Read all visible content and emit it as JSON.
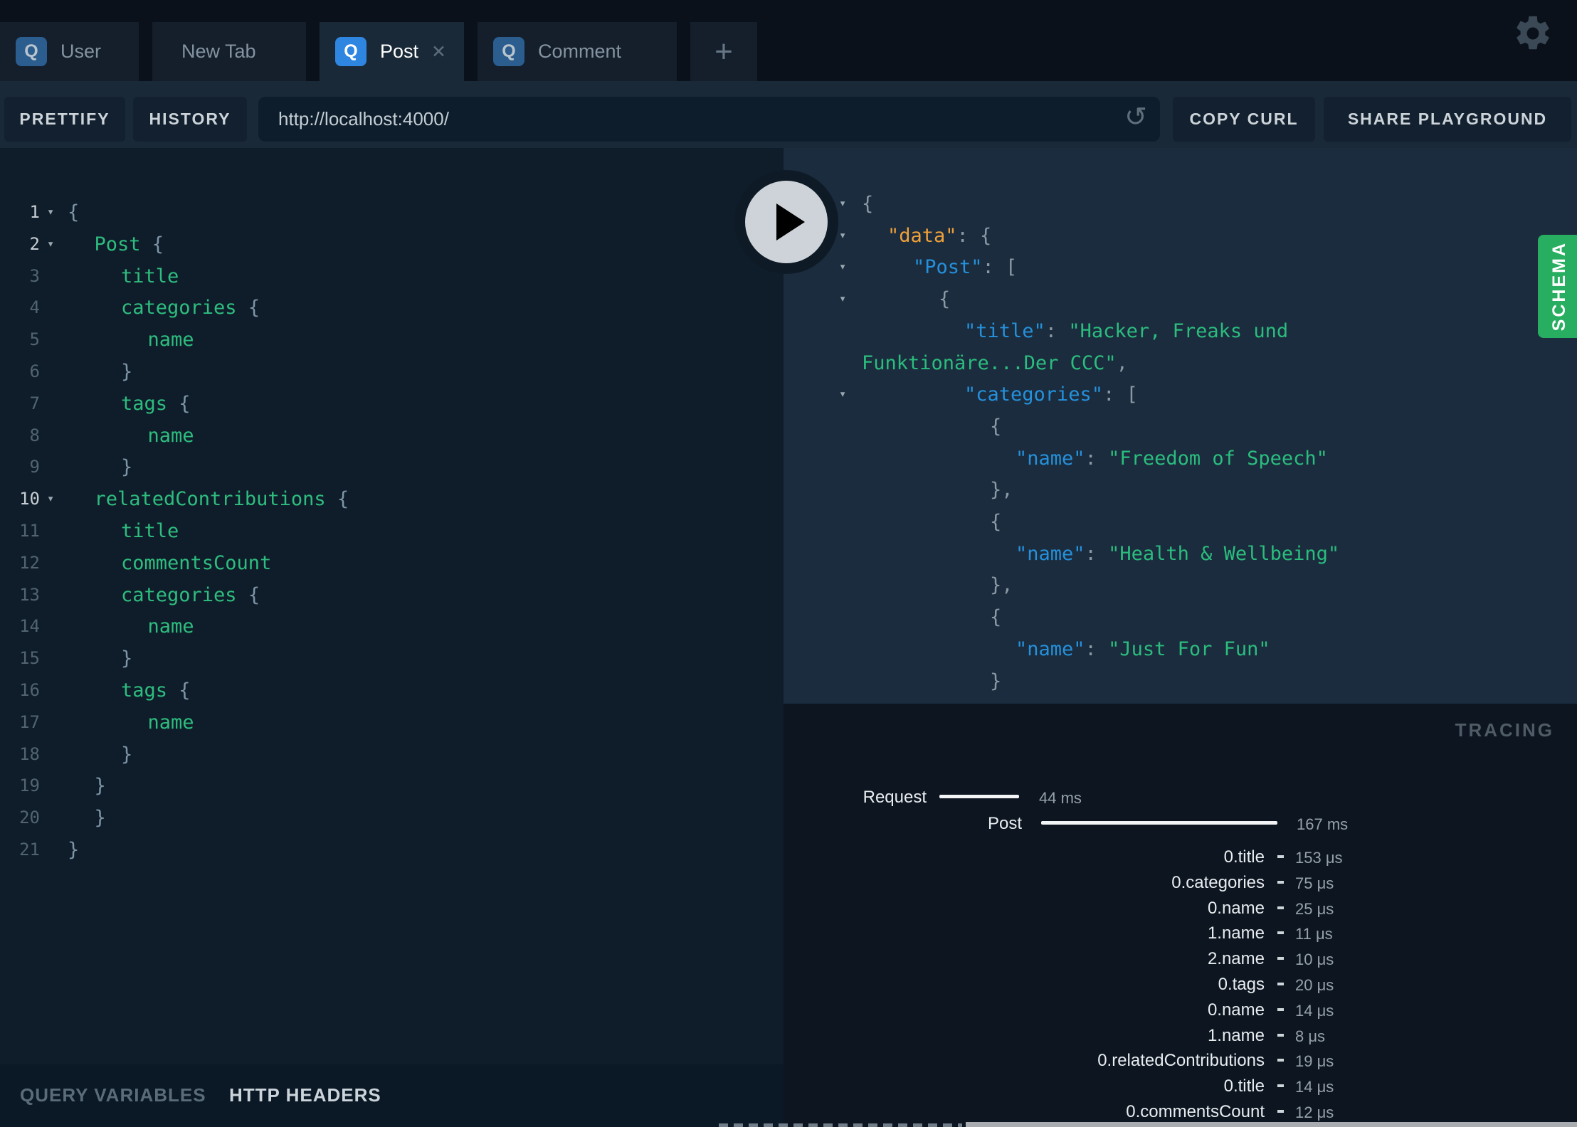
{
  "tabs": {
    "items": [
      {
        "label": "User",
        "badge": "Q",
        "active": false,
        "closable": false
      },
      {
        "label": "New Tab",
        "badge": "",
        "active": false,
        "closable": false
      },
      {
        "label": "Post",
        "badge": "Q",
        "active": true,
        "closable": true
      },
      {
        "label": "Comment",
        "badge": "Q",
        "active": false,
        "closable": false
      }
    ],
    "new_tab_button": "+"
  },
  "icons": {
    "settings": "gear-icon",
    "reload_glyph": "↺",
    "close_glyph": "✕",
    "fold_glyph": "▾",
    "play": "play-triangle"
  },
  "toolbar": {
    "prettify": "PRETTIFY",
    "history": "HISTORY",
    "url": "http://localhost:4000/",
    "copy_curl": "COPY CURL",
    "share_playground": "SHARE PLAYGROUND"
  },
  "query_editor": {
    "lines": [
      {
        "n": 1,
        "fold": true,
        "indent": 0,
        "tokens": [
          [
            "p",
            "{"
          ]
        ]
      },
      {
        "n": 2,
        "fold": true,
        "indent": 1,
        "tokens": [
          [
            "f",
            "Post"
          ],
          [
            "p",
            " {"
          ]
        ]
      },
      {
        "n": 3,
        "fold": false,
        "indent": 2,
        "tokens": [
          [
            "f",
            "title"
          ]
        ]
      },
      {
        "n": 4,
        "fold": false,
        "indent": 2,
        "tokens": [
          [
            "f",
            "categories"
          ],
          [
            "p",
            " {"
          ]
        ]
      },
      {
        "n": 5,
        "fold": false,
        "indent": 3,
        "tokens": [
          [
            "f",
            "name"
          ]
        ]
      },
      {
        "n": 6,
        "fold": false,
        "indent": 2,
        "tokens": [
          [
            "p",
            "}"
          ]
        ]
      },
      {
        "n": 7,
        "fold": false,
        "indent": 2,
        "tokens": [
          [
            "f",
            "tags"
          ],
          [
            "p",
            " {"
          ]
        ]
      },
      {
        "n": 8,
        "fold": false,
        "indent": 3,
        "tokens": [
          [
            "f",
            "name"
          ]
        ]
      },
      {
        "n": 9,
        "fold": false,
        "indent": 2,
        "tokens": [
          [
            "p",
            "}"
          ]
        ]
      },
      {
        "n": 10,
        "fold": true,
        "indent": 1,
        "tokens": [
          [
            "f",
            "relatedContributions"
          ],
          [
            "p",
            " {"
          ]
        ]
      },
      {
        "n": 11,
        "fold": false,
        "indent": 2,
        "tokens": [
          [
            "f",
            "title"
          ]
        ]
      },
      {
        "n": 12,
        "fold": false,
        "indent": 2,
        "tokens": [
          [
            "f",
            "commentsCount"
          ]
        ]
      },
      {
        "n": 13,
        "fold": false,
        "indent": 2,
        "tokens": [
          [
            "f",
            "categories"
          ],
          [
            "p",
            " {"
          ]
        ]
      },
      {
        "n": 14,
        "fold": false,
        "indent": 3,
        "tokens": [
          [
            "f",
            "name"
          ]
        ]
      },
      {
        "n": 15,
        "fold": false,
        "indent": 2,
        "tokens": [
          [
            "p",
            "}"
          ]
        ]
      },
      {
        "n": 16,
        "fold": false,
        "indent": 2,
        "tokens": [
          [
            "f",
            "tags"
          ],
          [
            "p",
            " {"
          ]
        ]
      },
      {
        "n": 17,
        "fold": false,
        "indent": 3,
        "tokens": [
          [
            "f",
            "name"
          ]
        ]
      },
      {
        "n": 18,
        "fold": false,
        "indent": 2,
        "tokens": [
          [
            "p",
            "}"
          ]
        ]
      },
      {
        "n": 19,
        "fold": false,
        "indent": 1,
        "tokens": [
          [
            "p",
            "}"
          ]
        ]
      },
      {
        "n": 20,
        "fold": false,
        "indent": 1,
        "tokens": [
          [
            "p",
            "}"
          ]
        ]
      },
      {
        "n": 21,
        "fold": false,
        "indent": 0,
        "tokens": [
          [
            "p",
            "}"
          ]
        ]
      }
    ]
  },
  "response": {
    "lines": [
      {
        "fold": true,
        "indent": 0,
        "tokens": [
          [
            "p",
            "{"
          ]
        ]
      },
      {
        "fold": true,
        "indent": 1,
        "tokens": [
          [
            "o",
            "\"data\""
          ],
          [
            "p",
            ": {"
          ]
        ]
      },
      {
        "fold": true,
        "indent": 2,
        "tokens": [
          [
            "k",
            "\"Post\""
          ],
          [
            "p",
            ": ["
          ]
        ]
      },
      {
        "fold": true,
        "indent": 3,
        "tokens": [
          [
            "p",
            "{"
          ]
        ]
      },
      {
        "fold": false,
        "indent": 4,
        "tokens": [
          [
            "k",
            "\"title\""
          ],
          [
            "p",
            ": "
          ],
          [
            "s",
            "\"Hacker, Freaks und"
          ]
        ]
      },
      {
        "fold": false,
        "indent": 0,
        "tokens": [
          [
            "s",
            "Funktionäre...Der CCC\""
          ],
          [
            "p",
            ","
          ]
        ]
      },
      {
        "fold": true,
        "indent": 4,
        "tokens": [
          [
            "k",
            "\"categories\""
          ],
          [
            "p",
            ": ["
          ]
        ]
      },
      {
        "fold": false,
        "indent": 5,
        "tokens": [
          [
            "p",
            "{"
          ]
        ]
      },
      {
        "fold": false,
        "indent": 6,
        "tokens": [
          [
            "k",
            "\"name\""
          ],
          [
            "p",
            ": "
          ],
          [
            "s",
            "\"Freedom of Speech\""
          ]
        ]
      },
      {
        "fold": false,
        "indent": 5,
        "tokens": [
          [
            "p",
            "},"
          ]
        ]
      },
      {
        "fold": false,
        "indent": 5,
        "tokens": [
          [
            "p",
            "{"
          ]
        ]
      },
      {
        "fold": false,
        "indent": 6,
        "tokens": [
          [
            "k",
            "\"name\""
          ],
          [
            "p",
            ": "
          ],
          [
            "s",
            "\"Health & Wellbeing\""
          ]
        ]
      },
      {
        "fold": false,
        "indent": 5,
        "tokens": [
          [
            "p",
            "},"
          ]
        ]
      },
      {
        "fold": false,
        "indent": 5,
        "tokens": [
          [
            "p",
            "{"
          ]
        ]
      },
      {
        "fold": false,
        "indent": 6,
        "tokens": [
          [
            "k",
            "\"name\""
          ],
          [
            "p",
            ": "
          ],
          [
            "s",
            "\"Just For Fun\""
          ]
        ]
      },
      {
        "fold": false,
        "indent": 5,
        "tokens": [
          [
            "p",
            "}"
          ]
        ]
      },
      {
        "fold": false,
        "indent": 4,
        "tokens": [
          [
            "p",
            "]"
          ]
        ]
      }
    ]
  },
  "schema_tab": {
    "label": "SCHEMA",
    "color": "#27ae60"
  },
  "tracing": {
    "header": "TRACING",
    "request": {
      "label": "Request",
      "duration": "44 ms"
    },
    "resolver": {
      "label": "Post",
      "duration": "167 ms"
    },
    "fields": [
      {
        "name": "0.title",
        "duration": "153 μs"
      },
      {
        "name": "0.categories",
        "duration": "75 μs"
      },
      {
        "name": "0.name",
        "duration": "25 μs"
      },
      {
        "name": "1.name",
        "duration": "11 μs"
      },
      {
        "name": "2.name",
        "duration": "10 μs"
      },
      {
        "name": "0.tags",
        "duration": "20 μs"
      },
      {
        "name": "0.name",
        "duration": "14 μs"
      },
      {
        "name": "1.name",
        "duration": "8 μs"
      },
      {
        "name": "0.relatedContributions",
        "duration": "19 μs"
      },
      {
        "name": "0.title",
        "duration": "14 μs"
      },
      {
        "name": "0.commentsCount",
        "duration": "12 μs"
      }
    ]
  },
  "footer": {
    "query_variables": "QUERY VARIABLES",
    "http_headers": "HTTP HEADERS"
  },
  "colors": {
    "accent_blue": "#2f86e0",
    "editor_green": "#2ebd7e",
    "response_key_blue": "#2591db",
    "response_data_orange": "#f0a13a",
    "response_string_green": "#2bbd7e",
    "schema_green": "#27ae60"
  }
}
